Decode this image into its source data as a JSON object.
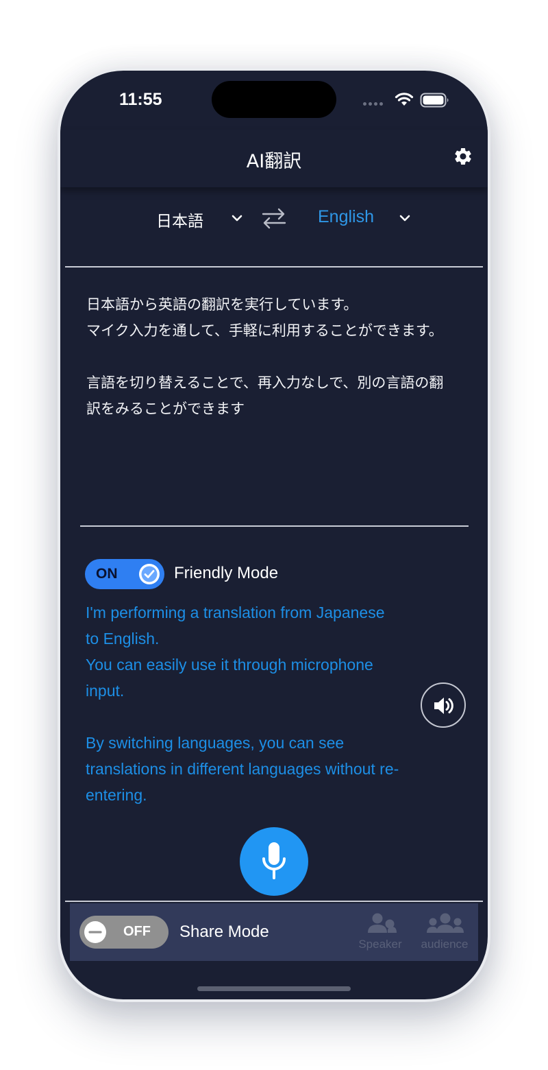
{
  "status_bar": {
    "time": "11:55",
    "wifi_icon": "wifi-icon",
    "battery_icon": "battery-icon"
  },
  "header": {
    "title": "AI翻訳",
    "settings_icon": "gear-icon"
  },
  "language_bar": {
    "source_language": "日本語",
    "target_language": "English",
    "swap_icon": "swap-arrows-icon"
  },
  "source": {
    "text": "日本語から英語の翻訳を実行しています。\nマイク入力を通して、手軽に利用することができます。\n\n言語を切り替えることで、再入力なしで、別の言語の翻訳をみることができます"
  },
  "friendly_mode": {
    "toggle_state": "ON",
    "label": "Friendly Mode"
  },
  "translation": {
    "text": "I'm performing a translation from Japanese to English.\nYou can easily use it through microphone input.\n\nBy switching languages, you can see translations in different languages without re-entering."
  },
  "share_mode": {
    "toggle_state": "OFF",
    "label": "Share Mode",
    "roles": [
      {
        "label": "Speaker",
        "icon": "speaker-person-icon"
      },
      {
        "label": "audience",
        "icon": "audience-group-icon"
      }
    ]
  },
  "colors": {
    "background": "#1a1f33",
    "accent_blue": "#2196f3",
    "translation_text": "#1d8fe6",
    "share_panel": "#323a5a"
  }
}
